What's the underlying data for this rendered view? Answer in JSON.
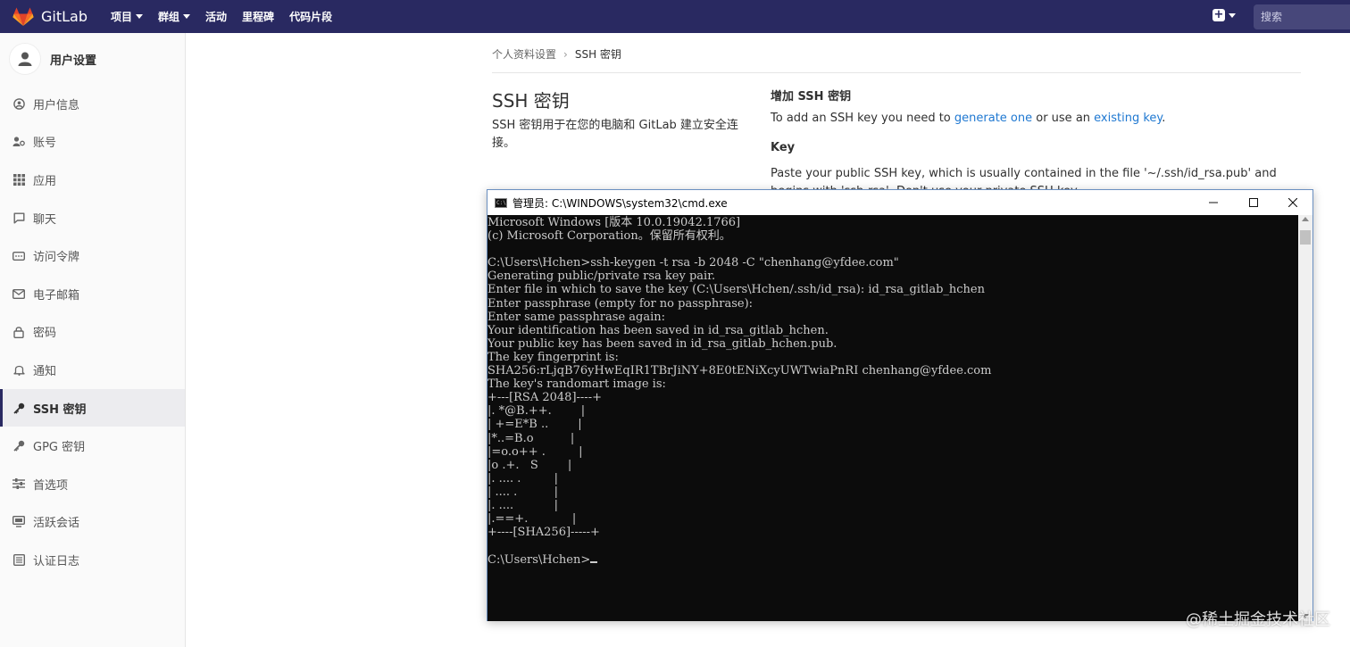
{
  "navbar": {
    "logo_text": "GitLab",
    "items": [
      {
        "label": "项目",
        "has_caret": true
      },
      {
        "label": "群组",
        "has_caret": true
      },
      {
        "label": "活动",
        "has_caret": false
      },
      {
        "label": "里程碑",
        "has_caret": false
      },
      {
        "label": "代码片段",
        "has_caret": false
      }
    ],
    "plus_symbol": "+",
    "search_placeholder": "搜索",
    "bg_color": "#292961"
  },
  "sidebar": {
    "title": "用户设置",
    "items": [
      {
        "label": "用户信息",
        "icon": "user-circle-icon"
      },
      {
        "label": "账号",
        "icon": "account-icon"
      },
      {
        "label": "应用",
        "icon": "applications-icon"
      },
      {
        "label": "聊天",
        "icon": "chat-icon"
      },
      {
        "label": "访问令牌",
        "icon": "token-icon"
      },
      {
        "label": "电子邮箱",
        "icon": "mail-icon"
      },
      {
        "label": "密码",
        "icon": "lock-icon"
      },
      {
        "label": "通知",
        "icon": "bell-icon"
      },
      {
        "label": "SSH 密钥",
        "icon": "key-icon",
        "active": true
      },
      {
        "label": "GPG 密钥",
        "icon": "key-icon"
      },
      {
        "label": "首选项",
        "icon": "preferences-icon"
      },
      {
        "label": "活跃会话",
        "icon": "monitor-icon"
      },
      {
        "label": "认证日志",
        "icon": "log-icon"
      }
    ]
  },
  "breadcrumb": {
    "parent": "个人资料设置",
    "separator": "›",
    "current": "SSH 密钥"
  },
  "main": {
    "title": "SSH 密钥",
    "description": "SSH 密钥用于在您的电脑和 GitLab 建立安全连接。",
    "add_title": "增加 SSH 密钥",
    "add_text_before": "To add an SSH key you need to ",
    "generate_link": "generate one",
    "add_text_middle": " or use an ",
    "existing_link": "existing key",
    "add_text_after": ".",
    "key_label": "Key",
    "paste_text": "Paste your public SSH key, which is usually contained in the file '~/.ssh/id_rsa.pub' and begins with 'ssh-rsa'. Don't use your private SSH key."
  },
  "cmd": {
    "title": "管理员: C:\\WINDOWS\\system32\\cmd.exe",
    "minimize": "—",
    "maximize": "☐",
    "close": "✕",
    "lines": [
      "Microsoft Windows [版本 10.0.19042.1766]",
      "(c) Microsoft Corporation。保留所有权利。",
      "",
      "C:\\Users\\Hchen>ssh-keygen -t rsa -b 2048 -C \"chenhang@yfdee.com\"",
      "Generating public/private rsa key pair.",
      "Enter file in which to save the key (C:\\Users\\Hchen/.ssh/id_rsa): id_rsa_gitlab_hchen",
      "Enter passphrase (empty for no passphrase):",
      "Enter same passphrase again:",
      "Your identification has been saved in id_rsa_gitlab_hchen.",
      "Your public key has been saved in id_rsa_gitlab_hchen.pub.",
      "The key fingerprint is:",
      "SHA256:rLjqB76yHwEqIR1TBrJiNY+8E0tENiXcyUWTwiaPnRI chenhang@yfdee.com",
      "The key's randomart image is:",
      "+---[RSA 2048]----+",
      "|. *@B.++.        |",
      "| +=E*B ..        |",
      "|*..=B.o          |",
      "|=o.o++ .         |",
      "|o .+.   S        |",
      "|. .... .         |",
      "| .... .          |",
      "|. ....           |",
      "|.==+.            |",
      "+----[SHA256]-----+",
      ""
    ],
    "prompt": "C:\\Users\\Hchen>"
  },
  "watermark": "@稀土掘金技术社区"
}
